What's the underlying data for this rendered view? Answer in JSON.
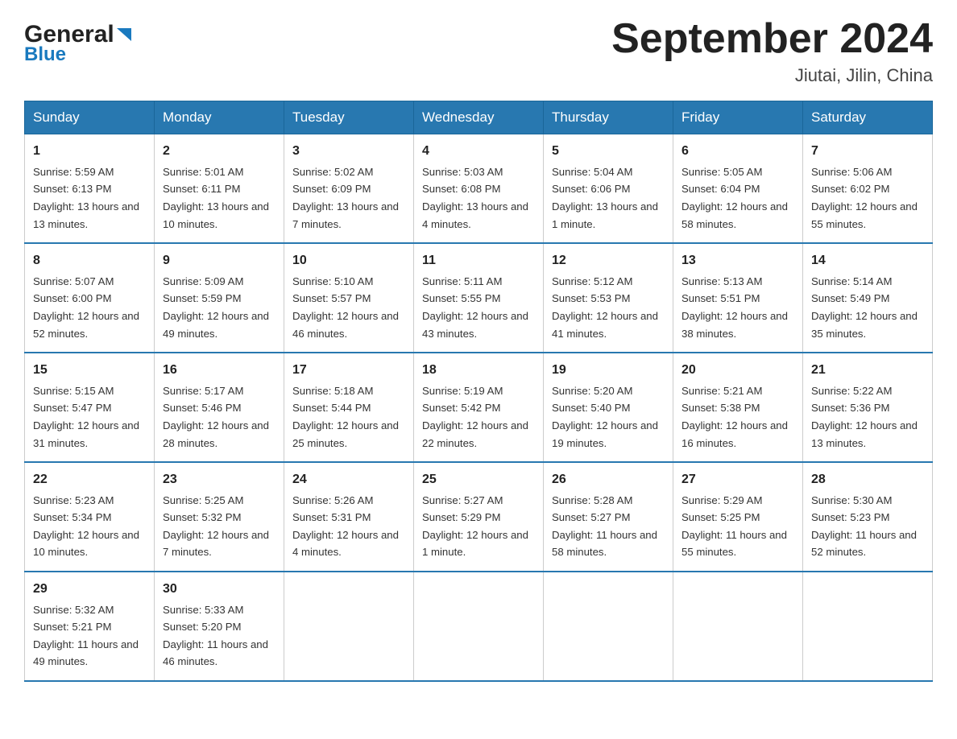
{
  "logo": {
    "general": "General",
    "blue": "Blue"
  },
  "title": "September 2024",
  "location": "Jiutai, Jilin, China",
  "weekdays": [
    "Sunday",
    "Monday",
    "Tuesday",
    "Wednesday",
    "Thursday",
    "Friday",
    "Saturday"
  ],
  "weeks": [
    [
      {
        "day": "1",
        "sunrise": "5:59 AM",
        "sunset": "6:13 PM",
        "daylight": "13 hours and 13 minutes."
      },
      {
        "day": "2",
        "sunrise": "5:01 AM",
        "sunset": "6:11 PM",
        "daylight": "13 hours and 10 minutes."
      },
      {
        "day": "3",
        "sunrise": "5:02 AM",
        "sunset": "6:09 PM",
        "daylight": "13 hours and 7 minutes."
      },
      {
        "day": "4",
        "sunrise": "5:03 AM",
        "sunset": "6:08 PM",
        "daylight": "13 hours and 4 minutes."
      },
      {
        "day": "5",
        "sunrise": "5:04 AM",
        "sunset": "6:06 PM",
        "daylight": "13 hours and 1 minute."
      },
      {
        "day": "6",
        "sunrise": "5:05 AM",
        "sunset": "6:04 PM",
        "daylight": "12 hours and 58 minutes."
      },
      {
        "day": "7",
        "sunrise": "5:06 AM",
        "sunset": "6:02 PM",
        "daylight": "12 hours and 55 minutes."
      }
    ],
    [
      {
        "day": "8",
        "sunrise": "5:07 AM",
        "sunset": "6:00 PM",
        "daylight": "12 hours and 52 minutes."
      },
      {
        "day": "9",
        "sunrise": "5:09 AM",
        "sunset": "5:59 PM",
        "daylight": "12 hours and 49 minutes."
      },
      {
        "day": "10",
        "sunrise": "5:10 AM",
        "sunset": "5:57 PM",
        "daylight": "12 hours and 46 minutes."
      },
      {
        "day": "11",
        "sunrise": "5:11 AM",
        "sunset": "5:55 PM",
        "daylight": "12 hours and 43 minutes."
      },
      {
        "day": "12",
        "sunrise": "5:12 AM",
        "sunset": "5:53 PM",
        "daylight": "12 hours and 41 minutes."
      },
      {
        "day": "13",
        "sunrise": "5:13 AM",
        "sunset": "5:51 PM",
        "daylight": "12 hours and 38 minutes."
      },
      {
        "day": "14",
        "sunrise": "5:14 AM",
        "sunset": "5:49 PM",
        "daylight": "12 hours and 35 minutes."
      }
    ],
    [
      {
        "day": "15",
        "sunrise": "5:15 AM",
        "sunset": "5:47 PM",
        "daylight": "12 hours and 31 minutes."
      },
      {
        "day": "16",
        "sunrise": "5:17 AM",
        "sunset": "5:46 PM",
        "daylight": "12 hours and 28 minutes."
      },
      {
        "day": "17",
        "sunrise": "5:18 AM",
        "sunset": "5:44 PM",
        "daylight": "12 hours and 25 minutes."
      },
      {
        "day": "18",
        "sunrise": "5:19 AM",
        "sunset": "5:42 PM",
        "daylight": "12 hours and 22 minutes."
      },
      {
        "day": "19",
        "sunrise": "5:20 AM",
        "sunset": "5:40 PM",
        "daylight": "12 hours and 19 minutes."
      },
      {
        "day": "20",
        "sunrise": "5:21 AM",
        "sunset": "5:38 PM",
        "daylight": "12 hours and 16 minutes."
      },
      {
        "day": "21",
        "sunrise": "5:22 AM",
        "sunset": "5:36 PM",
        "daylight": "12 hours and 13 minutes."
      }
    ],
    [
      {
        "day": "22",
        "sunrise": "5:23 AM",
        "sunset": "5:34 PM",
        "daylight": "12 hours and 10 minutes."
      },
      {
        "day": "23",
        "sunrise": "5:25 AM",
        "sunset": "5:32 PM",
        "daylight": "12 hours and 7 minutes."
      },
      {
        "day": "24",
        "sunrise": "5:26 AM",
        "sunset": "5:31 PM",
        "daylight": "12 hours and 4 minutes."
      },
      {
        "day": "25",
        "sunrise": "5:27 AM",
        "sunset": "5:29 PM",
        "daylight": "12 hours and 1 minute."
      },
      {
        "day": "26",
        "sunrise": "5:28 AM",
        "sunset": "5:27 PM",
        "daylight": "11 hours and 58 minutes."
      },
      {
        "day": "27",
        "sunrise": "5:29 AM",
        "sunset": "5:25 PM",
        "daylight": "11 hours and 55 minutes."
      },
      {
        "day": "28",
        "sunrise": "5:30 AM",
        "sunset": "5:23 PM",
        "daylight": "11 hours and 52 minutes."
      }
    ],
    [
      {
        "day": "29",
        "sunrise": "5:32 AM",
        "sunset": "5:21 PM",
        "daylight": "11 hours and 49 minutes."
      },
      {
        "day": "30",
        "sunrise": "5:33 AM",
        "sunset": "5:20 PM",
        "daylight": "11 hours and 46 minutes."
      },
      null,
      null,
      null,
      null,
      null
    ]
  ]
}
